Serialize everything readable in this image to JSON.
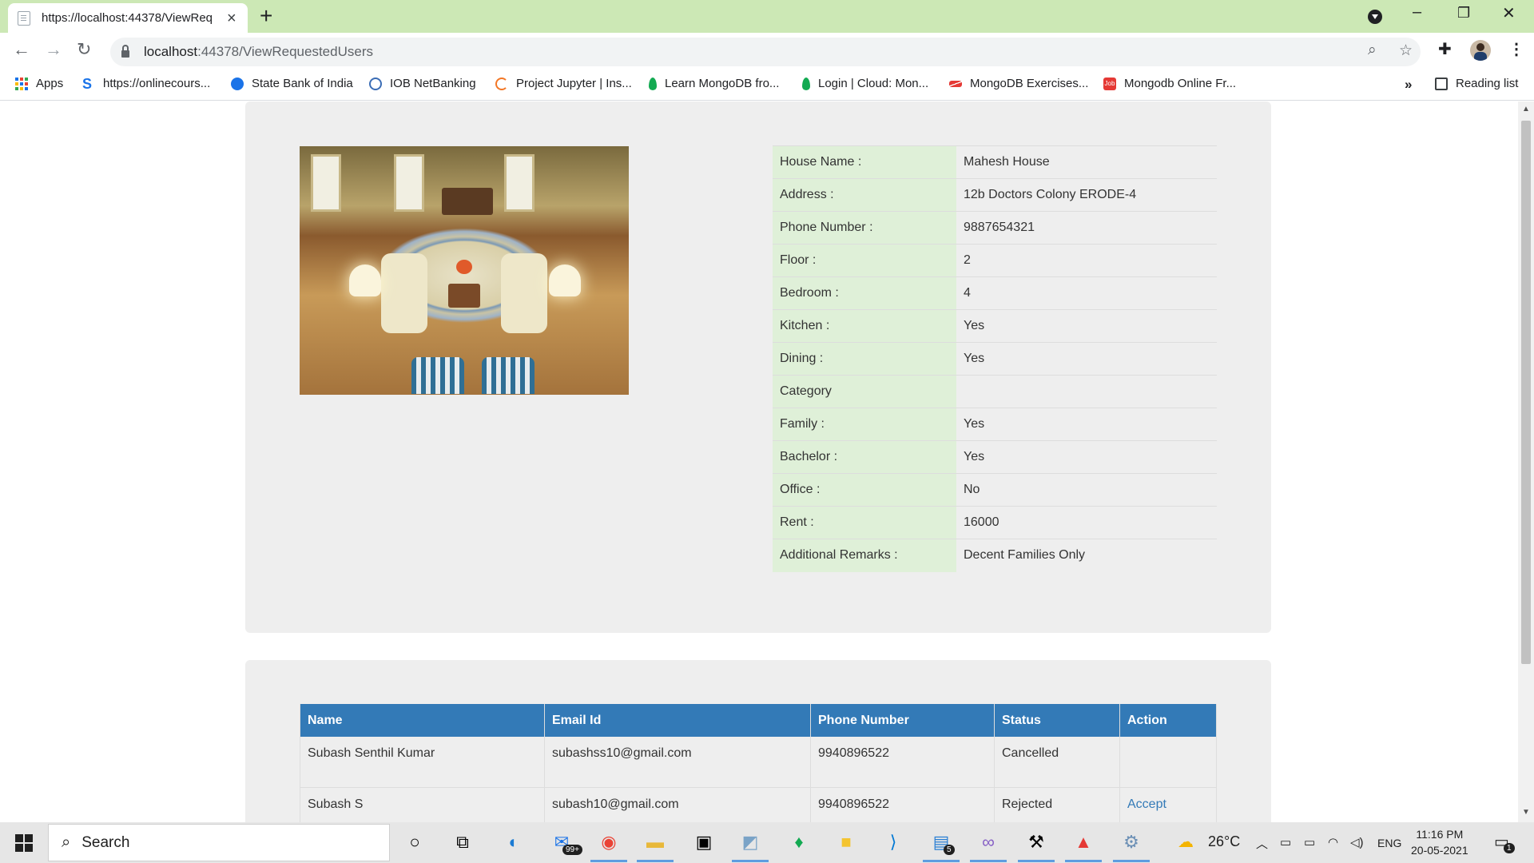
{
  "browser": {
    "tab_title": "https://localhost:44378/ViewReq",
    "url_host": "localhost",
    "url_path": ":44378/ViewRequestedUsers",
    "bookmarks": [
      {
        "label": "Apps"
      },
      {
        "label": "https://onlinecours..."
      },
      {
        "label": "State Bank of India"
      },
      {
        "label": "IOB NetBanking"
      },
      {
        "label": "Project Jupyter | Ins..."
      },
      {
        "label": "Learn MongoDB fro..."
      },
      {
        "label": "Login | Cloud: Mon..."
      },
      {
        "label": "MongoDB Exercises..."
      },
      {
        "label": "Mongodb Online Fr..."
      }
    ],
    "more_bookmarks": "»",
    "reading_list": "Reading list"
  },
  "house": {
    "details": [
      {
        "label": "House Name :",
        "value": "Mahesh House"
      },
      {
        "label": "Address :",
        "value": "12b Doctors Colony ERODE-4"
      },
      {
        "label": "Phone Number :",
        "value": "9887654321"
      },
      {
        "label": "Floor :",
        "value": "2"
      },
      {
        "label": "Bedroom :",
        "value": "4"
      },
      {
        "label": "Kitchen :",
        "value": "Yes"
      },
      {
        "label": "Dining :",
        "value": "Yes"
      },
      {
        "label": "Category",
        "value": ""
      },
      {
        "label": "Family :",
        "value": "Yes"
      },
      {
        "label": "Bachelor :",
        "value": "Yes"
      },
      {
        "label": "Office :",
        "value": "No"
      },
      {
        "label": "Rent :",
        "value": "16000"
      },
      {
        "label": "Additional Remarks :",
        "value": "Decent Families Only"
      }
    ]
  },
  "requests": {
    "columns": [
      "Name",
      "Email Id",
      "Phone Number",
      "Status",
      "Action"
    ],
    "rows": [
      {
        "name": "Subash Senthil Kumar",
        "email": "subashss10@gmail.com",
        "phone": "9940896522",
        "status": "Cancelled",
        "action": ""
      },
      {
        "name": "Subash S",
        "email": "subash10@gmail.com",
        "phone": "9940896522",
        "status": "Rejected",
        "action": "Accept"
      }
    ]
  },
  "taskbar": {
    "search_placeholder": "Search",
    "mail_badge": "99+",
    "files_badge": "5",
    "weather": "26°C",
    "language": "ENG",
    "time": "11:16 PM",
    "date": "20-05-2021",
    "notification_count": "1"
  },
  "colors": {
    "header_blue": "#337ab7",
    "label_green": "#dff0d8",
    "panel_gray": "#eeeeee",
    "chrome_green": "#cce8b5"
  }
}
